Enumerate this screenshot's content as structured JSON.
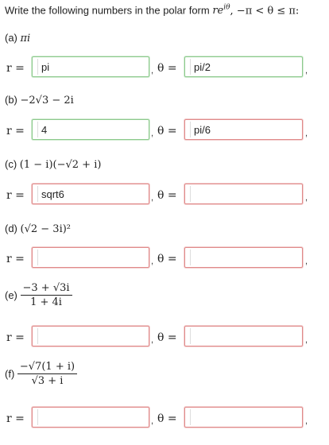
{
  "intro": {
    "text": "Write the following numbers in the polar form ",
    "form_r": "r",
    "form_e": "e",
    "form_exp": "iθ",
    "constraint": ", −π < θ ≤ π:"
  },
  "labels": {
    "r_eq": "r =",
    "theta_eq": "θ =",
    "comma": ","
  },
  "parts": [
    {
      "letter": "(a)",
      "expr": "πi",
      "r_value": "pi",
      "r_state": "ok",
      "theta_value": "pi/2",
      "theta_state": "ok"
    },
    {
      "letter": "(b)",
      "expr": "−2√3  −  2i",
      "r_value": "4",
      "r_state": "ok",
      "theta_value": "pi/6",
      "theta_state": "bad"
    },
    {
      "letter": "(c)",
      "expr": "(1  −  i)(−√2  +  i)",
      "r_value": "sqrt6",
      "r_state": "bad",
      "theta_value": "",
      "theta_state": "bad"
    },
    {
      "letter": "(d)",
      "expr": "(√2  −  3i)²",
      "r_value": "",
      "r_state": "bad",
      "theta_value": "",
      "theta_state": "bad"
    },
    {
      "letter": "(e)",
      "numerator": "−3  +  √3i",
      "denominator": "1  +  4i",
      "r_value": "",
      "r_state": "bad",
      "theta_value": "",
      "theta_state": "bad"
    },
    {
      "letter": "(f)",
      "numerator": "−√7(1  +  i)",
      "denominator": "√3  +  i",
      "r_value": "",
      "r_state": "bad",
      "theta_value": "",
      "theta_state": "bad"
    }
  ]
}
